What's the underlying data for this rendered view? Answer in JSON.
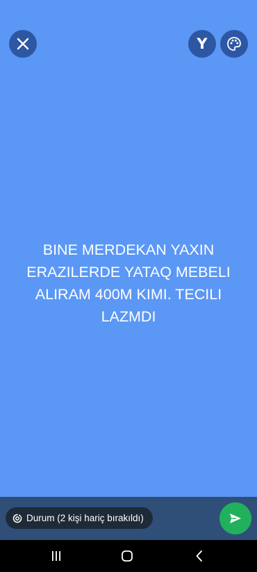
{
  "toolbar": {
    "close_icon": "close-icon",
    "font_button_label": "Y",
    "palette_icon": "palette-icon"
  },
  "status": {
    "text": "BINE MERDEKAN YAXIN ERAZILERDE YATAQ MEBELI ALIRAM 400M KIMI. TECILI LAZMDI",
    "background_color": "#5b97f5",
    "text_color": "#ffffff"
  },
  "composer": {
    "audience_icon": "status-ring-icon",
    "audience_label": "Durum (2 kişi hariç bırakıldı)",
    "send_icon": "send-icon",
    "send_color": "#21b15c"
  },
  "navigation": {
    "recents_icon": "recents-icon",
    "home_icon": "home-icon",
    "back_icon": "back-icon"
  }
}
